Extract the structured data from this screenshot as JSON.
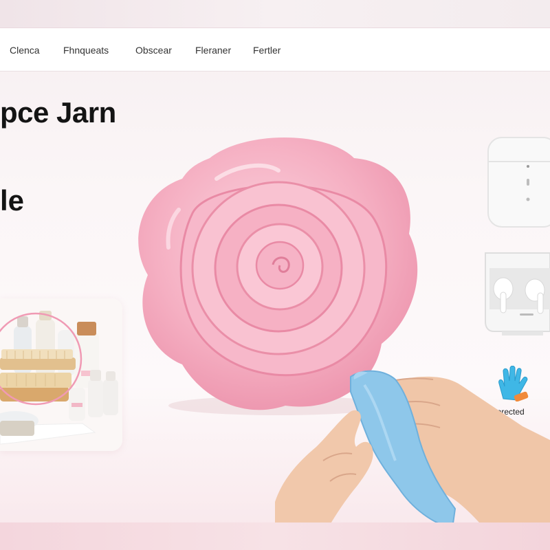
{
  "nav": {
    "items": [
      {
        "label": "Clenca"
      },
      {
        "label": "Fhnqueats"
      },
      {
        "label": "Obscear"
      },
      {
        "label": "Fleraner"
      },
      {
        "label": "Fertler"
      }
    ]
  },
  "hero": {
    "title": "pce Jarn",
    "subtitle": "le"
  },
  "badge": {
    "label": "uprected",
    "icon": "glove-icon"
  },
  "colors": {
    "accent_pink": "#f4a9bd",
    "glove_blue": "#3fb7e6",
    "cloth_blue": "#8ec7ea"
  },
  "images": {
    "hero_product": "rose-shaped-pink-product",
    "side_product": "earbuds-case",
    "card_product": "bath-brushes-and-bottles"
  }
}
